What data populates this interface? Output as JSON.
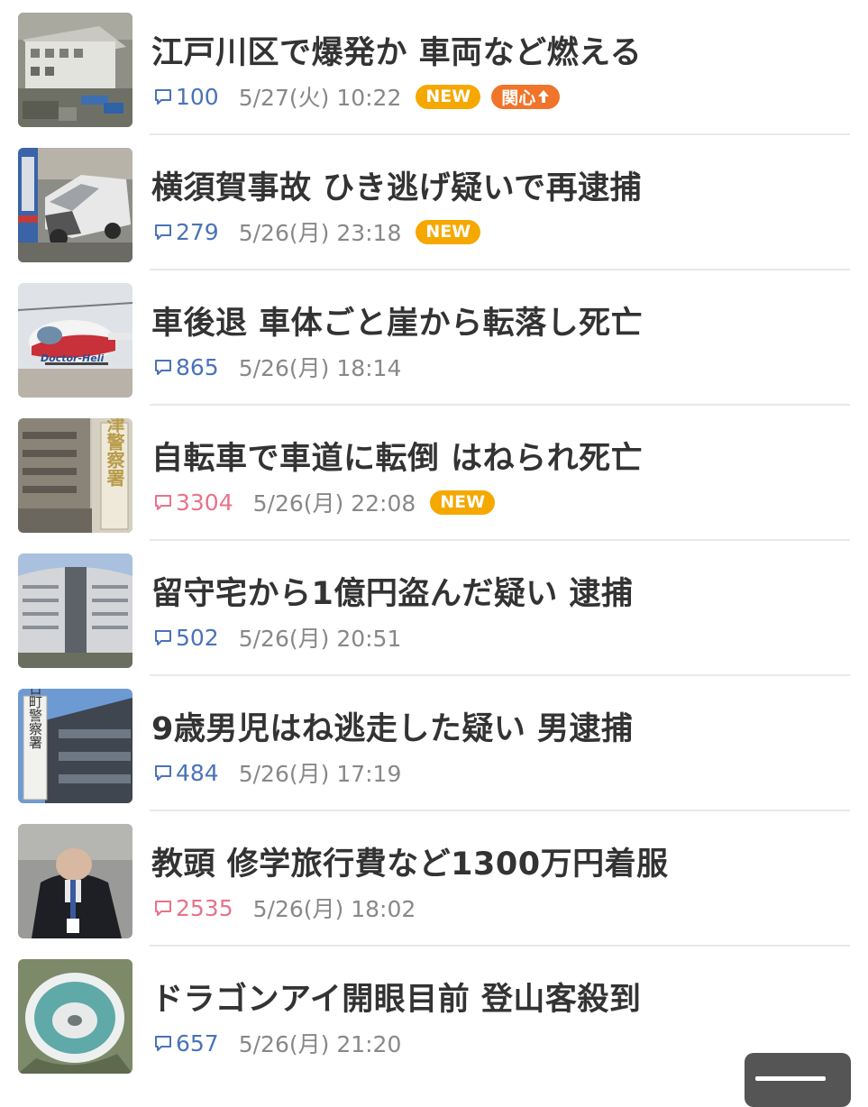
{
  "articles": [
    {
      "title": "江戸川区で爆発か 車両など燃える",
      "comments": "100",
      "comment_color": "blue",
      "date": "5/27(火) 10:22",
      "badge_new": "NEW",
      "badge_interest": "関心",
      "thumbnail": "building-fire-aerial"
    },
    {
      "title": "横須賀事故 ひき逃げ疑いで再逮捕",
      "comments": "279",
      "comment_color": "blue",
      "date": "5/26(月) 23:18",
      "badge_new": "NEW",
      "thumbnail": "crashed-car"
    },
    {
      "title": "車後退 車体ごと崖から転落し死亡",
      "comments": "865",
      "comment_color": "blue",
      "date": "5/26(月) 18:14",
      "thumbnail": "doctor-heli",
      "thumbnail_text": "Doctor-Heli"
    },
    {
      "title": "自転車で車道に転倒 はねられ死亡",
      "comments": "3304",
      "comment_color": "red",
      "date": "5/26(月) 22:08",
      "badge_new": "NEW",
      "thumbnail": "police-station-sign",
      "thumbnail_text": "大津警察署"
    },
    {
      "title": "留守宅から1億円盗んだ疑い 逮捕",
      "comments": "502",
      "comment_color": "blue",
      "date": "5/26(月) 20:51",
      "thumbnail": "police-headquarters"
    },
    {
      "title": "9歳男児はね逃走した疑い 男逮捕",
      "comments": "484",
      "comment_color": "blue",
      "date": "5/26(月) 17:19",
      "thumbnail": "police-station-sign",
      "thumbnail_text": "向日町警察署"
    },
    {
      "title": "教頭 修学旅行費など1300万円着服",
      "comments": "2535",
      "comment_color": "red",
      "date": "5/26(月) 18:02",
      "thumbnail": "bowing-official"
    },
    {
      "title": "ドラゴンアイ開眼目前 登山客殺到",
      "comments": "657",
      "comment_color": "blue",
      "date": "5/26(月) 21:20",
      "thumbnail": "dragon-eye-lake"
    }
  ],
  "icons": {
    "comment": "comment-bubble-icon",
    "interest_arrow": "arrow-up-icon"
  },
  "colors": {
    "title": "#333333",
    "comment_blue": "#4a73b8",
    "comment_red": "#e8738a",
    "date": "#888888",
    "badge_new": "#f5a800",
    "badge_interest": "#f0742a",
    "divider": "#e8e8e8"
  }
}
